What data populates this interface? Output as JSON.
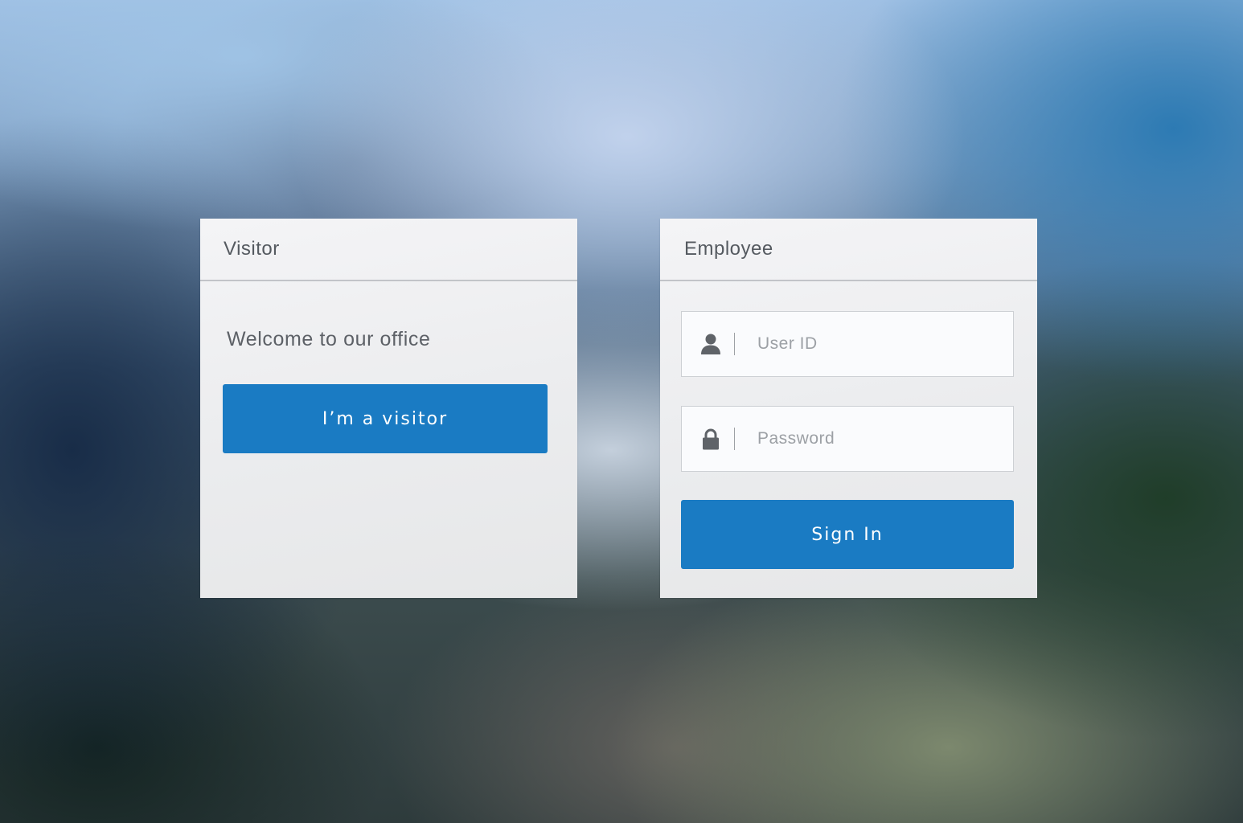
{
  "visitor_card": {
    "title": "Visitor",
    "welcome_text": "Welcome to our office",
    "button_label": "I’m a visitor"
  },
  "employee_card": {
    "title": "Employee",
    "user_id": {
      "placeholder": "User ID",
      "value": "",
      "icon": "user-icon"
    },
    "password": {
      "placeholder": "Password",
      "value": "",
      "icon": "lock-icon"
    },
    "sign_in_label": "Sign In"
  },
  "colors": {
    "primary_button": "#1a7bc3",
    "card_background": "#eeeff1",
    "text": "#555a60",
    "placeholder": "#9ca0a5",
    "icon": "#5f6368"
  }
}
